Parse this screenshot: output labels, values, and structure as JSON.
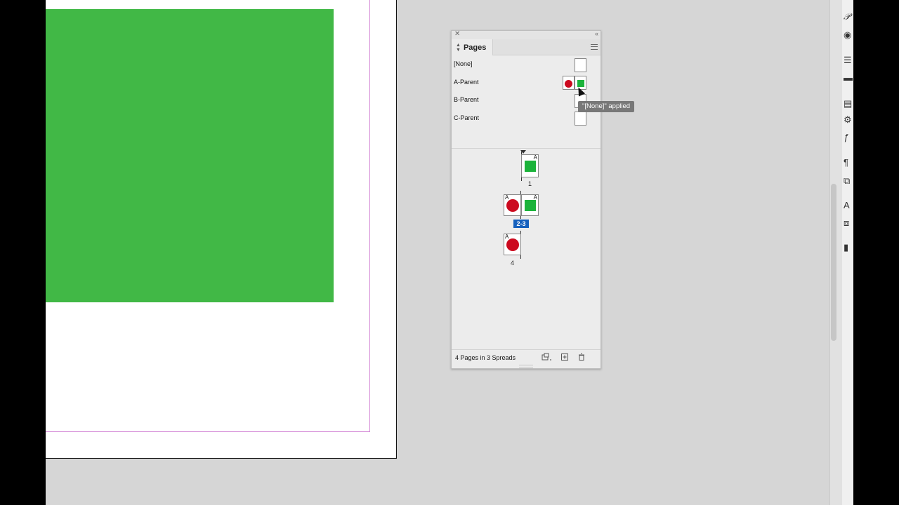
{
  "pages_panel": {
    "tab_label": "Pages",
    "parents": [
      {
        "label": "[None]"
      },
      {
        "label": "A-Parent"
      },
      {
        "label": "B-Parent"
      },
      {
        "label": "C-Parent"
      }
    ],
    "spreads": [
      {
        "label": "1",
        "selected": false
      },
      {
        "label": "2-3",
        "selected": true
      },
      {
        "label": "4",
        "selected": false
      }
    ],
    "page_prefix": "A",
    "footer_status": "4 Pages in 3 Spreads"
  },
  "tooltip": "\"[None]\" applied",
  "colors": {
    "green": "#41b846",
    "red": "#cc0a1f",
    "selection": "#1560bd"
  },
  "icons": [
    "close-icon",
    "collapse-icon",
    "panel-menu-icon",
    "edit-page-size-icon",
    "new-page-icon",
    "trash-icon"
  ]
}
